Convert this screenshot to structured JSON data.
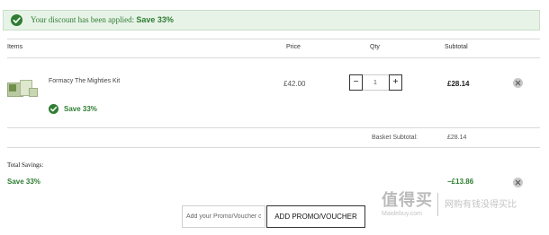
{
  "banner": {
    "message": "Your discount has been applied:",
    "highlight": "Save 33%"
  },
  "table_headers": {
    "items": "Items",
    "price": "Price",
    "qty": "Qty",
    "subtotal": "Subtotal"
  },
  "line_item": {
    "name": "Formacy The Mighties Kit",
    "discount_badge": "Save 33%",
    "price": "£42.00",
    "quantity": "1",
    "subtotal": "£28.14",
    "decrement_symbol": "−",
    "increment_symbol": "+"
  },
  "basket": {
    "subtotal_label": "Basket Subtotal:",
    "subtotal_value": "£28.14"
  },
  "savings": {
    "label": "Total Savings:",
    "name": "Save 33%",
    "value": "−£13.86"
  },
  "promo": {
    "placeholder": "Add your Promo/Voucher c",
    "button_label": "ADD PROMO/VOUCHER"
  },
  "watermark": {
    "logo": "值得买",
    "sub": "Maidebuy.com",
    "tagline": "网购有钱没得买比"
  },
  "colors": {
    "success_green": "#2e7d32",
    "banner_bg": "#e8f3e8",
    "remove_gray": "#c8c8c8"
  }
}
